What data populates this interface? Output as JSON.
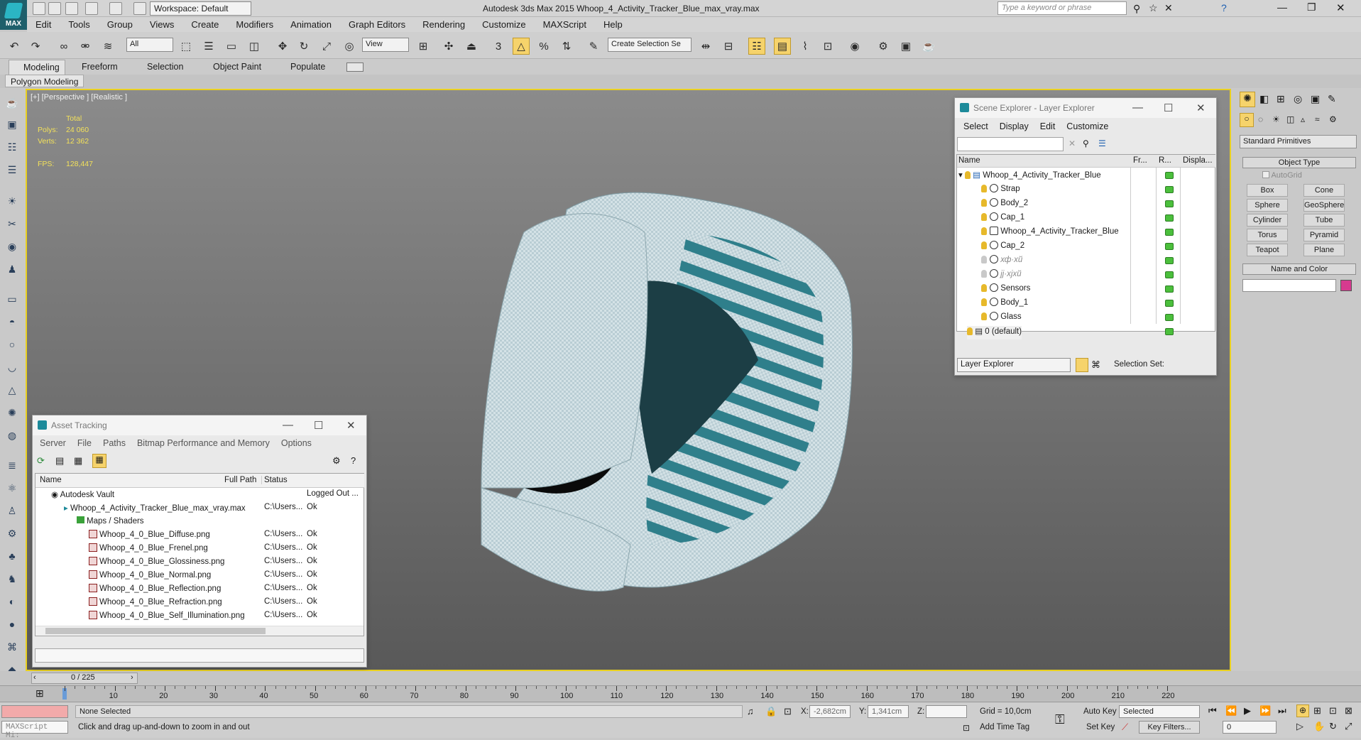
{
  "app": {
    "title": "Autodesk 3ds Max  2015    Whoop_4_Activity_Tracker_Blue_max_vray.max",
    "logo": "MAX",
    "workspace": "Workspace: Default",
    "search_placeholder": "Type a keyword or phrase"
  },
  "menu": [
    "Edit",
    "Tools",
    "Group",
    "Views",
    "Create",
    "Modifiers",
    "Animation",
    "Graph Editors",
    "Rendering",
    "Customize",
    "MAXScript",
    "Help"
  ],
  "toolbar": {
    "filter": "All",
    "refcoord": "View",
    "selset": "Create Selection Se"
  },
  "ribbon": {
    "tabs": [
      "Modeling",
      "Freeform",
      "Selection",
      "Object Paint",
      "Populate"
    ],
    "panel": "Polygon Modeling"
  },
  "viewport": {
    "label": "[+] [Perspective ] [Realistic ]",
    "stats": {
      "total_label": "Total",
      "polys_label": "Polys:",
      "polys": "24 060",
      "verts_label": "Verts:",
      "verts": "12 362",
      "fps_label": "FPS:",
      "fps": "128,447"
    }
  },
  "asset_tracking": {
    "title": "Asset Tracking",
    "menu": [
      "Server",
      "File",
      "Paths",
      "Bitmap Performance and Memory",
      "Options"
    ],
    "columns": [
      "Name",
      "Full Path",
      "Status"
    ],
    "rows": [
      {
        "name": "Autodesk Vault",
        "path": "",
        "status": "Logged Out ..."
      },
      {
        "name": "Whoop_4_Activity_Tracker_Blue_max_vray.max",
        "path": "C:\\Users...",
        "status": "Ok"
      },
      {
        "name": "Maps / Shaders",
        "path": "",
        "status": ""
      },
      {
        "name": "Whoop_4_0_Blue_Diffuse.png",
        "path": "C:\\Users...",
        "status": "Ok"
      },
      {
        "name": "Whoop_4_0_Blue_Frenel.png",
        "path": "C:\\Users...",
        "status": "Ok"
      },
      {
        "name": "Whoop_4_0_Blue_Glossiness.png",
        "path": "C:\\Users...",
        "status": "Ok"
      },
      {
        "name": "Whoop_4_0_Blue_Normal.png",
        "path": "C:\\Users...",
        "status": "Ok"
      },
      {
        "name": "Whoop_4_0_Blue_Reflection.png",
        "path": "C:\\Users...",
        "status": "Ok"
      },
      {
        "name": "Whoop_4_0_Blue_Refraction.png",
        "path": "C:\\Users...",
        "status": "Ok"
      },
      {
        "name": "Whoop_4_0_Blue_Self_Illumination.png",
        "path": "C:\\Users...",
        "status": "Ok"
      }
    ]
  },
  "scene_explorer": {
    "title": "Scene Explorer - Layer Explorer",
    "menu": [
      "Select",
      "Display",
      "Edit",
      "Customize"
    ],
    "columns": [
      "Name",
      "Fr...",
      "R...",
      "Displa..."
    ],
    "rows": [
      "Whoop_4_Activity_Tracker_Blue",
      "Strap",
      "Body_2",
      "Cap_1",
      "Whoop_4_Activity_Tracker_Blue",
      "Cap_2",
      "хф·хй",
      "јј·хјхй",
      "Sensors",
      "Body_1",
      "Glass",
      "0 (default)"
    ],
    "footer_dropdown": "Layer Explorer",
    "selection_set": "Selection Set:"
  },
  "command_panel": {
    "category": "Standard Primitives",
    "object_type": "Object Type",
    "autogrid": "AutoGrid",
    "buttons": [
      "Box",
      "Cone",
      "Sphere",
      "GeoSphere",
      "Cylinder",
      "Tube",
      "Torus",
      "Pyramid",
      "Teapot",
      "Plane"
    ],
    "name_color": "Name and Color",
    "color": "#d63a8f"
  },
  "timeline": {
    "frame": "0 / 225",
    "ticks": [
      "0",
      "10",
      "20",
      "30",
      "40",
      "50",
      "60",
      "70",
      "80",
      "90",
      "100",
      "110",
      "120",
      "130",
      "140",
      "150",
      "160",
      "170",
      "180",
      "190",
      "200",
      "210",
      "220"
    ]
  },
  "status": {
    "listener": "MAXScript Mi:",
    "selected": "None Selected",
    "prompt": "Click and drag up-and-down to zoom in and out",
    "x_label": "X:",
    "x": "-2,682cm",
    "y_label": "Y:",
    "y": "1,341cm",
    "z_label": "Z:",
    "z": "",
    "grid": "Grid = 10,0cm",
    "add_time_tag": "Add Time Tag",
    "auto_key": "Auto Key",
    "set_key": "Set Key",
    "selected_dd": "Selected",
    "key_filters": "Key Filters...",
    "frame_field": "0"
  }
}
